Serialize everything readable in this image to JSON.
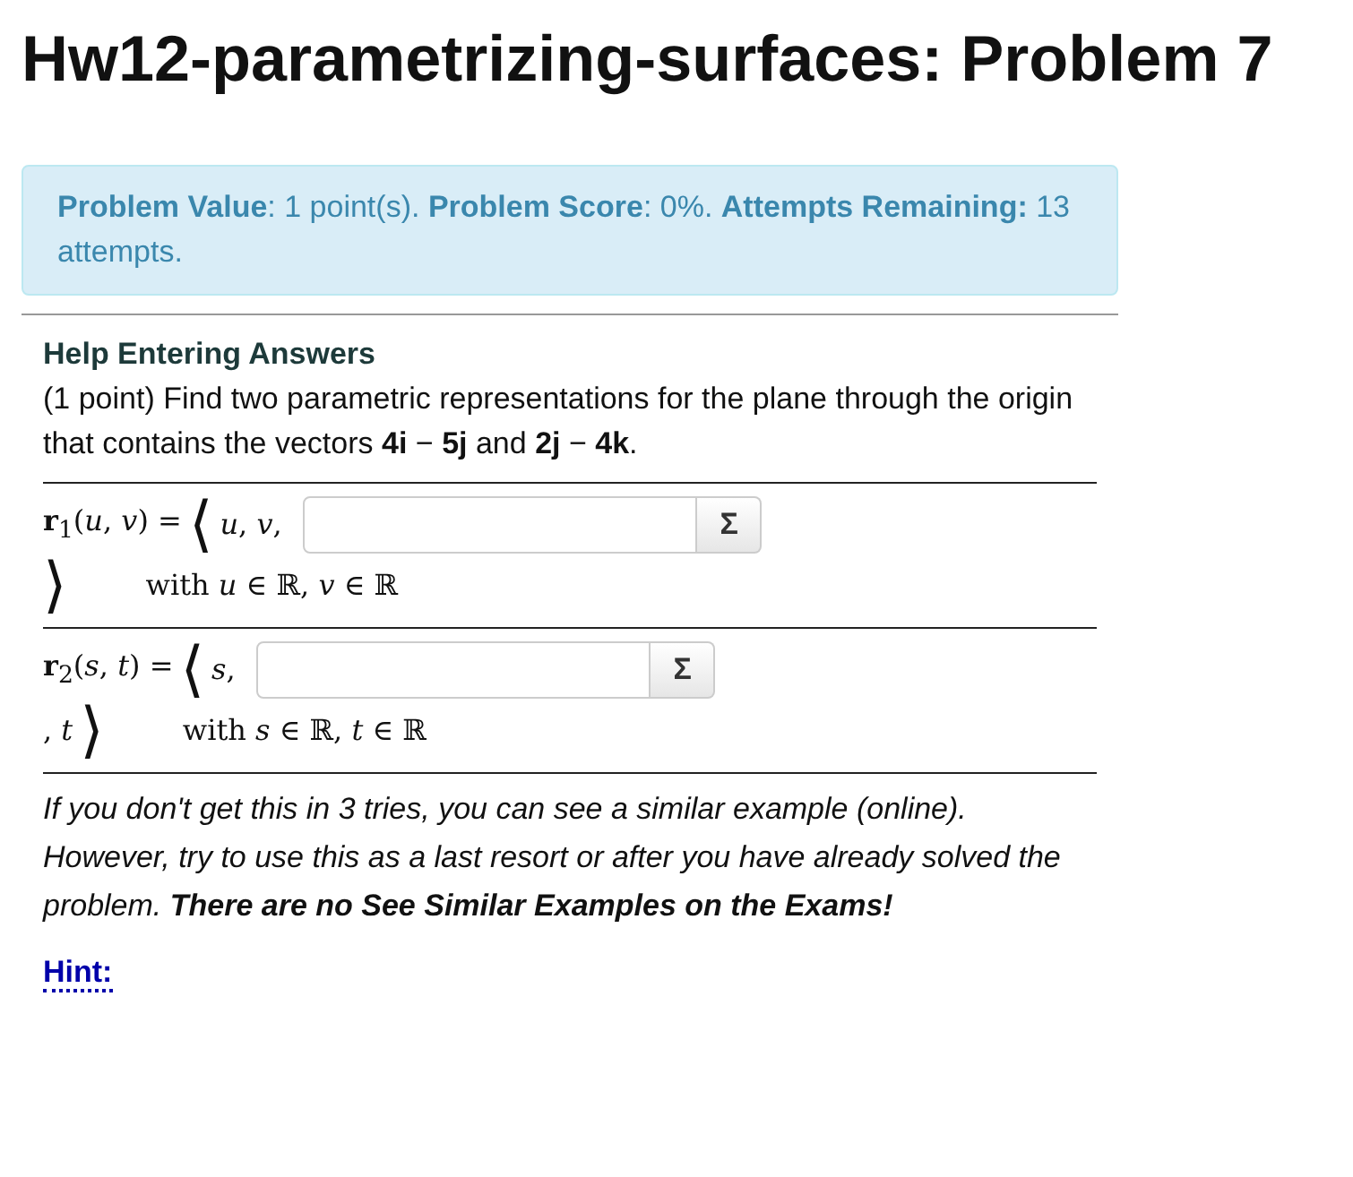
{
  "title": "Hw12-parametrizing-surfaces: Problem 7",
  "status": "**Problem Value**: 1 point(s). **Problem Score**: 0%. **Attempts Remaining:** 13 attempts.",
  "help_heading": "Help Entering Answers",
  "problem_text": "(1 point) Find two parametric representations for the plane through the origin that contains the vectors **4i** − **5j** and **2j** − **4k**.",
  "answers": [
    {
      "lhs": "**r**$_{1}$(*u*, *v*) = ",
      "open": "⟨",
      "prefix": "*u*, *v*,",
      "button": "Σ",
      "close": "⟩",
      "domain": "with *u* ∈ ℝ, *v* ∈ ℝ"
    },
    {
      "lhs": "**r**$_{2}$(*s*, *t*) = ",
      "open": "⟨",
      "prefix": "*s*,",
      "button": "Σ",
      "close_prefix": ", *t*",
      "close": "⟩",
      "domain": "with *s* ∈ ℝ, *t* ∈ ℝ"
    }
  ],
  "note": "If you don't get this in 3 tries, you can see a similar example (online). However, try to use this as a last resort or after you have already solved the problem. **There are no See Similar Examples on the Exams!**",
  "hint": "Hint:"
}
